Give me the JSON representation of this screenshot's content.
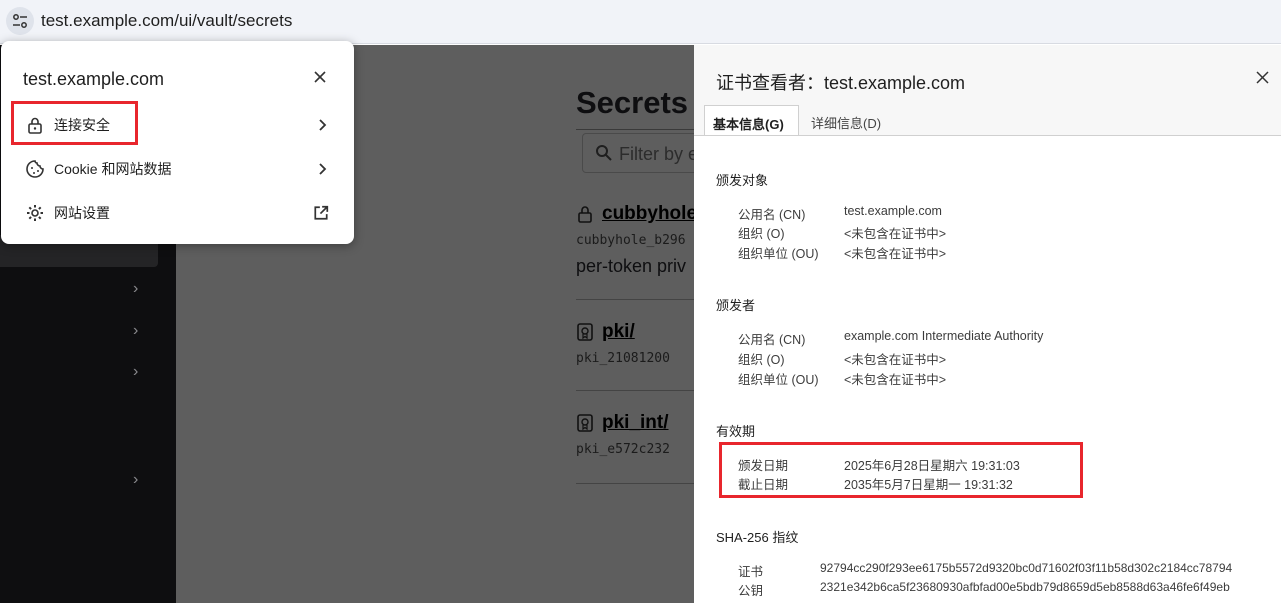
{
  "browser": {
    "url": "test.example.com/ui/vault/secrets"
  },
  "vault_page": {
    "title": "Secrets",
    "filter_placeholder": "Filter by e",
    "engines": [
      {
        "name": "cubbyhole",
        "path": "cubbyhole_b296",
        "description": "per-token priv"
      },
      {
        "name": "pki/",
        "path": "pki_21081200"
      },
      {
        "name": "pki_int/",
        "path": "pki_e572c232"
      }
    ]
  },
  "site_popup": {
    "domain": "test.example.com",
    "items": [
      {
        "label": "连接安全",
        "icon": "lock-icon",
        "tail": "chevron-right-icon"
      },
      {
        "label": "Cookie 和网站数据",
        "icon": "cookie-icon",
        "tail": "chevron-right-icon"
      },
      {
        "label": "网站设置",
        "icon": "gear-icon",
        "tail": "open-external-icon"
      }
    ]
  },
  "cert_viewer": {
    "title": "证书查看者：test.example.com",
    "tabs": [
      "基本信息(G)",
      "详细信息(D)"
    ],
    "issued_to": {
      "heading": "颁发对象",
      "rows": [
        {
          "key": "公用名 (CN)",
          "value": "test.example.com"
        },
        {
          "key": "组织 (O)",
          "value": "<未包含在证书中>"
        },
        {
          "key": "组织单位 (OU)",
          "value": "<未包含在证书中>"
        }
      ]
    },
    "issued_by": {
      "heading": "颁发者",
      "rows": [
        {
          "key": "公用名 (CN)",
          "value": "example.com Intermediate Authority"
        },
        {
          "key": "组织 (O)",
          "value": "<未包含在证书中>"
        },
        {
          "key": "组织单位 (OU)",
          "value": "<未包含在证书中>"
        }
      ]
    },
    "validity": {
      "heading": "有效期",
      "rows": [
        {
          "key": "颁发日期",
          "value": "2025年6月28日星期六 19:31:03"
        },
        {
          "key": "截止日期",
          "value": "2035年5月7日星期一 19:31:32"
        }
      ]
    },
    "fingerprints": {
      "heading": "SHA-256 指纹",
      "rows": [
        {
          "key": "证书",
          "value": "92794cc290f293ee6175b5572d9320bc0d71602f03f11b58d302c2184cc78794"
        },
        {
          "key": "公钥",
          "value": "2321e342b6ca5f23680930afbfad00e5bdb79d8659d5eb8588d63a46fe6f49eb"
        }
      ]
    }
  },
  "colors": {
    "highlight_box": "#e8262d",
    "overlay_bg": "#5e5e5e",
    "sidebar_bg": "#0e0e10"
  }
}
